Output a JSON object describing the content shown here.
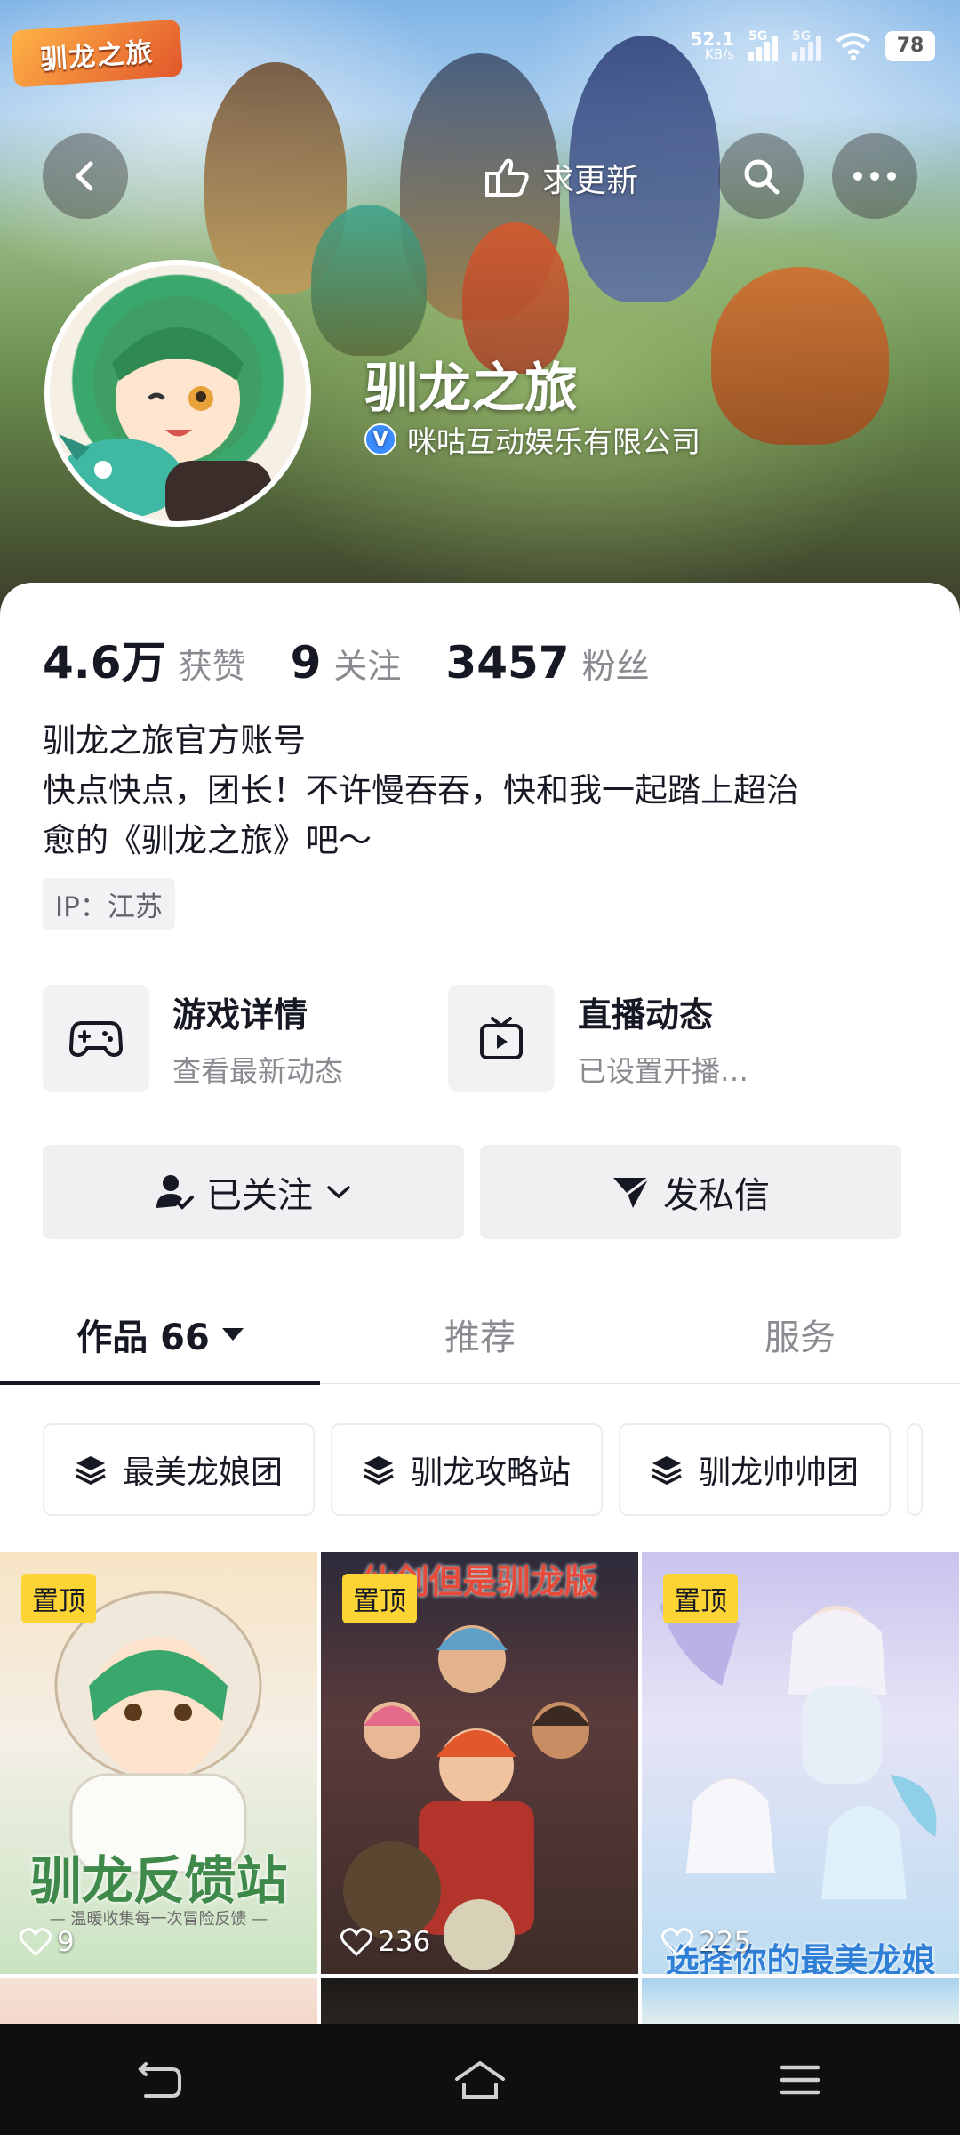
{
  "status_bar": {
    "app_logo_text": "驯龙之旅",
    "net_speed_value": "52.1",
    "net_speed_unit": "KB/s",
    "signal1_label": "5G",
    "signal2_label": "5G",
    "battery": "78"
  },
  "header": {
    "ask_update_label": "求更新",
    "icons": [
      "back-icon",
      "ask-update-icon",
      "search-icon",
      "more-icon"
    ]
  },
  "profile": {
    "name": "驯龙之旅",
    "verified_company": "咪咕互动娱乐有限公司",
    "verified_badge": "V"
  },
  "stats": [
    {
      "value": "4.6万",
      "label": "获赞"
    },
    {
      "value": "9",
      "label": "关注"
    },
    {
      "value": "3457",
      "label": "粉丝"
    }
  ],
  "bio": {
    "line1": "驯龙之旅官方账号",
    "line2": "快点快点，团长！不许慢吞吞，快和我一起踏上超治",
    "line3": "愈的《驯龙之旅》吧～"
  },
  "ip_tag": "IP：江苏",
  "features": [
    {
      "title": "游戏详情",
      "subtitle": "查看最新动态",
      "icon": "gamepad-icon"
    },
    {
      "title": "直播动态",
      "subtitle": "已设置开播…",
      "icon": "tv-play-icon"
    }
  ],
  "actions": {
    "follow_label": "已关注",
    "message_label": "发私信"
  },
  "tabs": [
    {
      "label": "作品 66",
      "active": true
    },
    {
      "label": "推荐",
      "active": false
    },
    {
      "label": "服务",
      "active": false
    }
  ],
  "collections": [
    "最美龙娘团",
    "驯龙攻略站",
    "驯龙帅帅团"
  ],
  "videos": [
    {
      "pinned": "置顶",
      "likes": "9",
      "title": "驯龙反馈站",
      "subtitle": "— 温暖收集每一次冒险反馈 —"
    },
    {
      "pinned": "置顶",
      "likes": "236",
      "title": "仙剑但是驯龙版",
      "subtitle": ""
    },
    {
      "pinned": "置顶",
      "likes": "225",
      "title": "选择你的最美龙娘",
      "subtitle": ""
    }
  ],
  "colors": {
    "accent_yellow": "#fcd535",
    "text_primary": "#161823",
    "text_secondary": "#8a8b91",
    "verified_blue": "#3b8cff"
  }
}
